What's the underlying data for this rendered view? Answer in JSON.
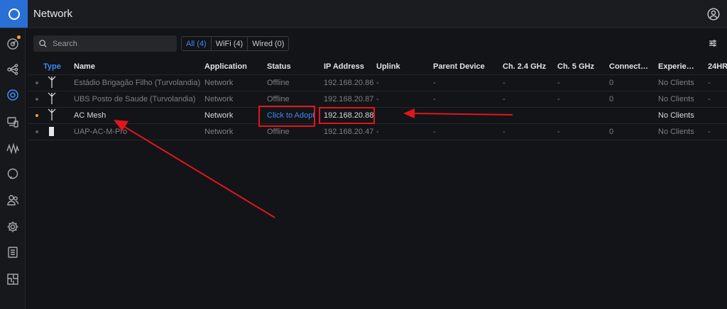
{
  "app": {
    "title": "Network"
  },
  "search": {
    "placeholder": "Search"
  },
  "filters": [
    {
      "label": "All (4)",
      "active": true
    },
    {
      "label": "WiFi (4)",
      "active": false
    },
    {
      "label": "Wired (0)",
      "active": false
    }
  ],
  "table": {
    "columns": [
      "Type",
      "Name",
      "Application",
      "Status",
      "IP Address",
      "Uplink",
      "Parent Device",
      "Ch. 2.4 GHz",
      "Ch. 5 GHz",
      "Connect…",
      "Experie…",
      "24HR"
    ],
    "rows": [
      {
        "name": "Estádio Brigagão Filho (Turvolandia)",
        "application": "Network",
        "status": "Offline",
        "ip": "192.168.20.86",
        "uplink": "-",
        "parent": "-",
        "ch24": "-",
        "ch5": "-",
        "connected": "0",
        "experience": "No Clients",
        "h24": "-"
      },
      {
        "name": "UBS Posto de Saude (Turvolandia)",
        "application": "Network",
        "status": "Offline",
        "ip": "192.168.20.87",
        "uplink": "-",
        "parent": "-",
        "ch24": "-",
        "ch5": "-",
        "connected": "0",
        "experience": "No Clients",
        "h24": "-"
      },
      {
        "name": "AC Mesh",
        "application": "Network",
        "status": "Click to Adopt",
        "ip": "192.168.20.88",
        "uplink": "",
        "parent": "",
        "ch24": "",
        "ch5": "",
        "connected": "",
        "experience": "No Clients",
        "h24": ""
      },
      {
        "name": "UAP-AC-M-Pro",
        "application": "Network",
        "status": "Offline",
        "ip": "192.168.20.47",
        "uplink": "-",
        "parent": "-",
        "ch24": "-",
        "ch5": "-",
        "connected": "0",
        "experience": "No Clients",
        "h24": "-"
      }
    ]
  },
  "icons": {
    "logo": "unifi-logo-icon",
    "user": "user-account-icon",
    "settings": "table-settings-icon",
    "sidebar": [
      "dashboard-icon",
      "topology-icon",
      "devices-icon",
      "clients-icon",
      "statistics-icon",
      "insights-icon",
      "users-icon",
      "settings-icon",
      "logs-icon",
      "floorplan-icon"
    ]
  },
  "colors": {
    "accent": "#3d8af7",
    "pending": "#f5a623",
    "annotation": "#e0151d"
  }
}
